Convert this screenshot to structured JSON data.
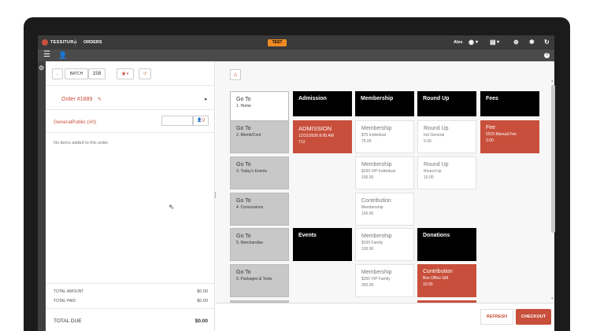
{
  "topbar": {
    "brand": "TESSITURA",
    "nav_orders": "ORDERS",
    "env_badge": "TEST",
    "user": "Alex",
    "icons": [
      "user-icon",
      "list-icon",
      "plus-icon",
      "settings-icon",
      "refresh-icon"
    ]
  },
  "batch": {
    "back_label": "←",
    "batch_label": "BATCH",
    "batch_number": "158",
    "print_label": "▣ ▾",
    "undo_label": "↺"
  },
  "order": {
    "number_label": "Order #1889",
    "customer_label": "GeneralPublic (#0)",
    "customer_button": "👤Q",
    "empty_message": "No items added to this order."
  },
  "totals": {
    "amount_label": "TOTAL AMOUNT",
    "amount_value": "$0.00",
    "paid_label": "TOTAL PAID",
    "paid_value": "$0.00",
    "due_label": "TOTAL DUE",
    "due_value": "$0.00"
  },
  "tiles": {
    "goto": [
      {
        "title": "Go To",
        "subtitle": "1. Home"
      },
      {
        "title": "Go To",
        "subtitle": "2. Memb/Cont"
      },
      {
        "title": "Go To",
        "subtitle": "3. Today's Events"
      },
      {
        "title": "Go To",
        "subtitle": "4. Concessions"
      },
      {
        "title": "Go To",
        "subtitle": "5. Merchandise"
      },
      {
        "title": "Go To",
        "subtitle": "6. Packages & Tests"
      }
    ],
    "admission_header": "Admission",
    "admission_item": {
      "title": "ADMISSION",
      "line1": "12/31/2026 8:00 AM",
      "line2": "713"
    },
    "events_header": "Events",
    "membership_header": "Membership",
    "membership_items": [
      {
        "title": "Membership",
        "line1": "$75 Individual",
        "line2": "75.00"
      },
      {
        "title": "Membership",
        "line1": "$100 VIP Individual",
        "line2": "100.00"
      },
      {
        "title": "Contribution",
        "line1": "Membership",
        "line2": "100.00"
      },
      {
        "title": "Membership",
        "line1": "$100 Family",
        "line2": "100.00"
      },
      {
        "title": "Membership",
        "line1": "$250 VIP Family",
        "line2": "250.00"
      }
    ],
    "roundup_header": "Round Up",
    "roundup_items": [
      {
        "title": "Round Up",
        "line1": "Ind General",
        "line2": "5.00"
      },
      {
        "title": "Round Up",
        "line1": "Round Up",
        "line2": "10.00"
      }
    ],
    "donations_header": "Donations",
    "donation_item": {
      "title": "Contribution",
      "line1": "Box Office Gift",
      "line2": "10.00"
    },
    "fees_header": "Fees",
    "fee_item": {
      "title": "Fee",
      "line1": "2015 Manual Fee",
      "line2": "3.00"
    }
  },
  "actions": {
    "refresh": "REFRESH",
    "checkout": "CHECKOUT"
  },
  "colors": {
    "accent": "#c84f3b",
    "topbar": "#3a3a3a",
    "env_badge": "#f08a24"
  }
}
